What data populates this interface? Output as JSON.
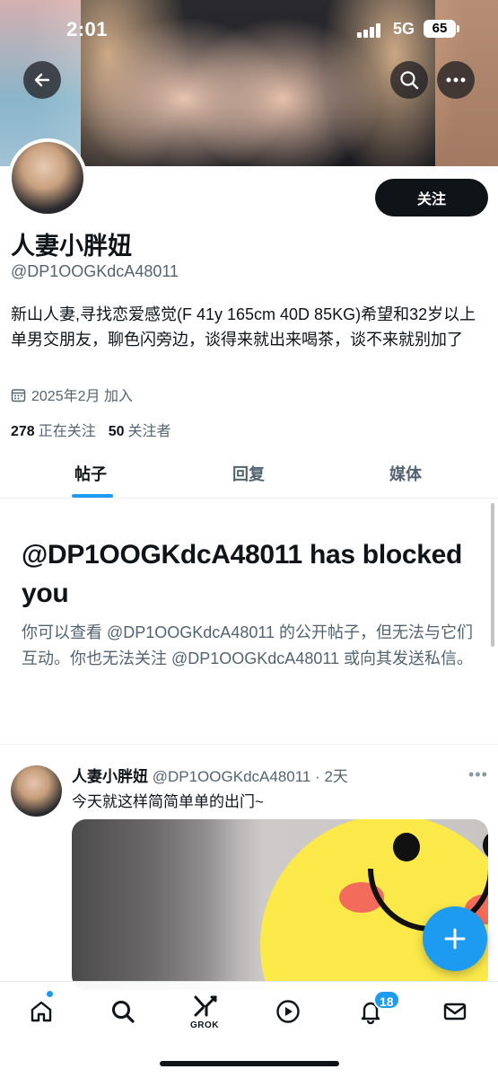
{
  "status_bar": {
    "time": "2:01",
    "network": "5G",
    "battery": "65"
  },
  "profile": {
    "follow_label": "关注",
    "display_name": "人妻小胖妞",
    "handle": "@DP1OOGKdcA48011",
    "bio": "新山人妻,寻找恋爱感觉(F 41y 165cm 40D 85KG)希望和32岁以上单男交朋友，聊色闪旁边，谈得来就出来喝茶，谈不来就别加了",
    "joined": "2025年2月 加入",
    "following_count": "278",
    "following_label": "正在关注",
    "followers_count": "50",
    "followers_label": "关注者"
  },
  "tabs": [
    {
      "label": "帖子"
    },
    {
      "label": "回复"
    },
    {
      "label": "媒体"
    }
  ],
  "blocked": {
    "title": "@DP1OOGKdcA48011 has blocked you",
    "body": "你可以查看 @DP1OOGKdcA48011 的公开帖子，但无法与它们互动。你也无法关注 @DP1OOGKdcA48011 或向其发送私信。"
  },
  "tweet": {
    "name": "人妻小胖妞",
    "meta": "@DP1OOGKdcA48011 · 2天",
    "text": "今天就这样简简单单的出门~"
  },
  "nav": {
    "grok_label": "GROK",
    "notifications_badge": "18"
  }
}
